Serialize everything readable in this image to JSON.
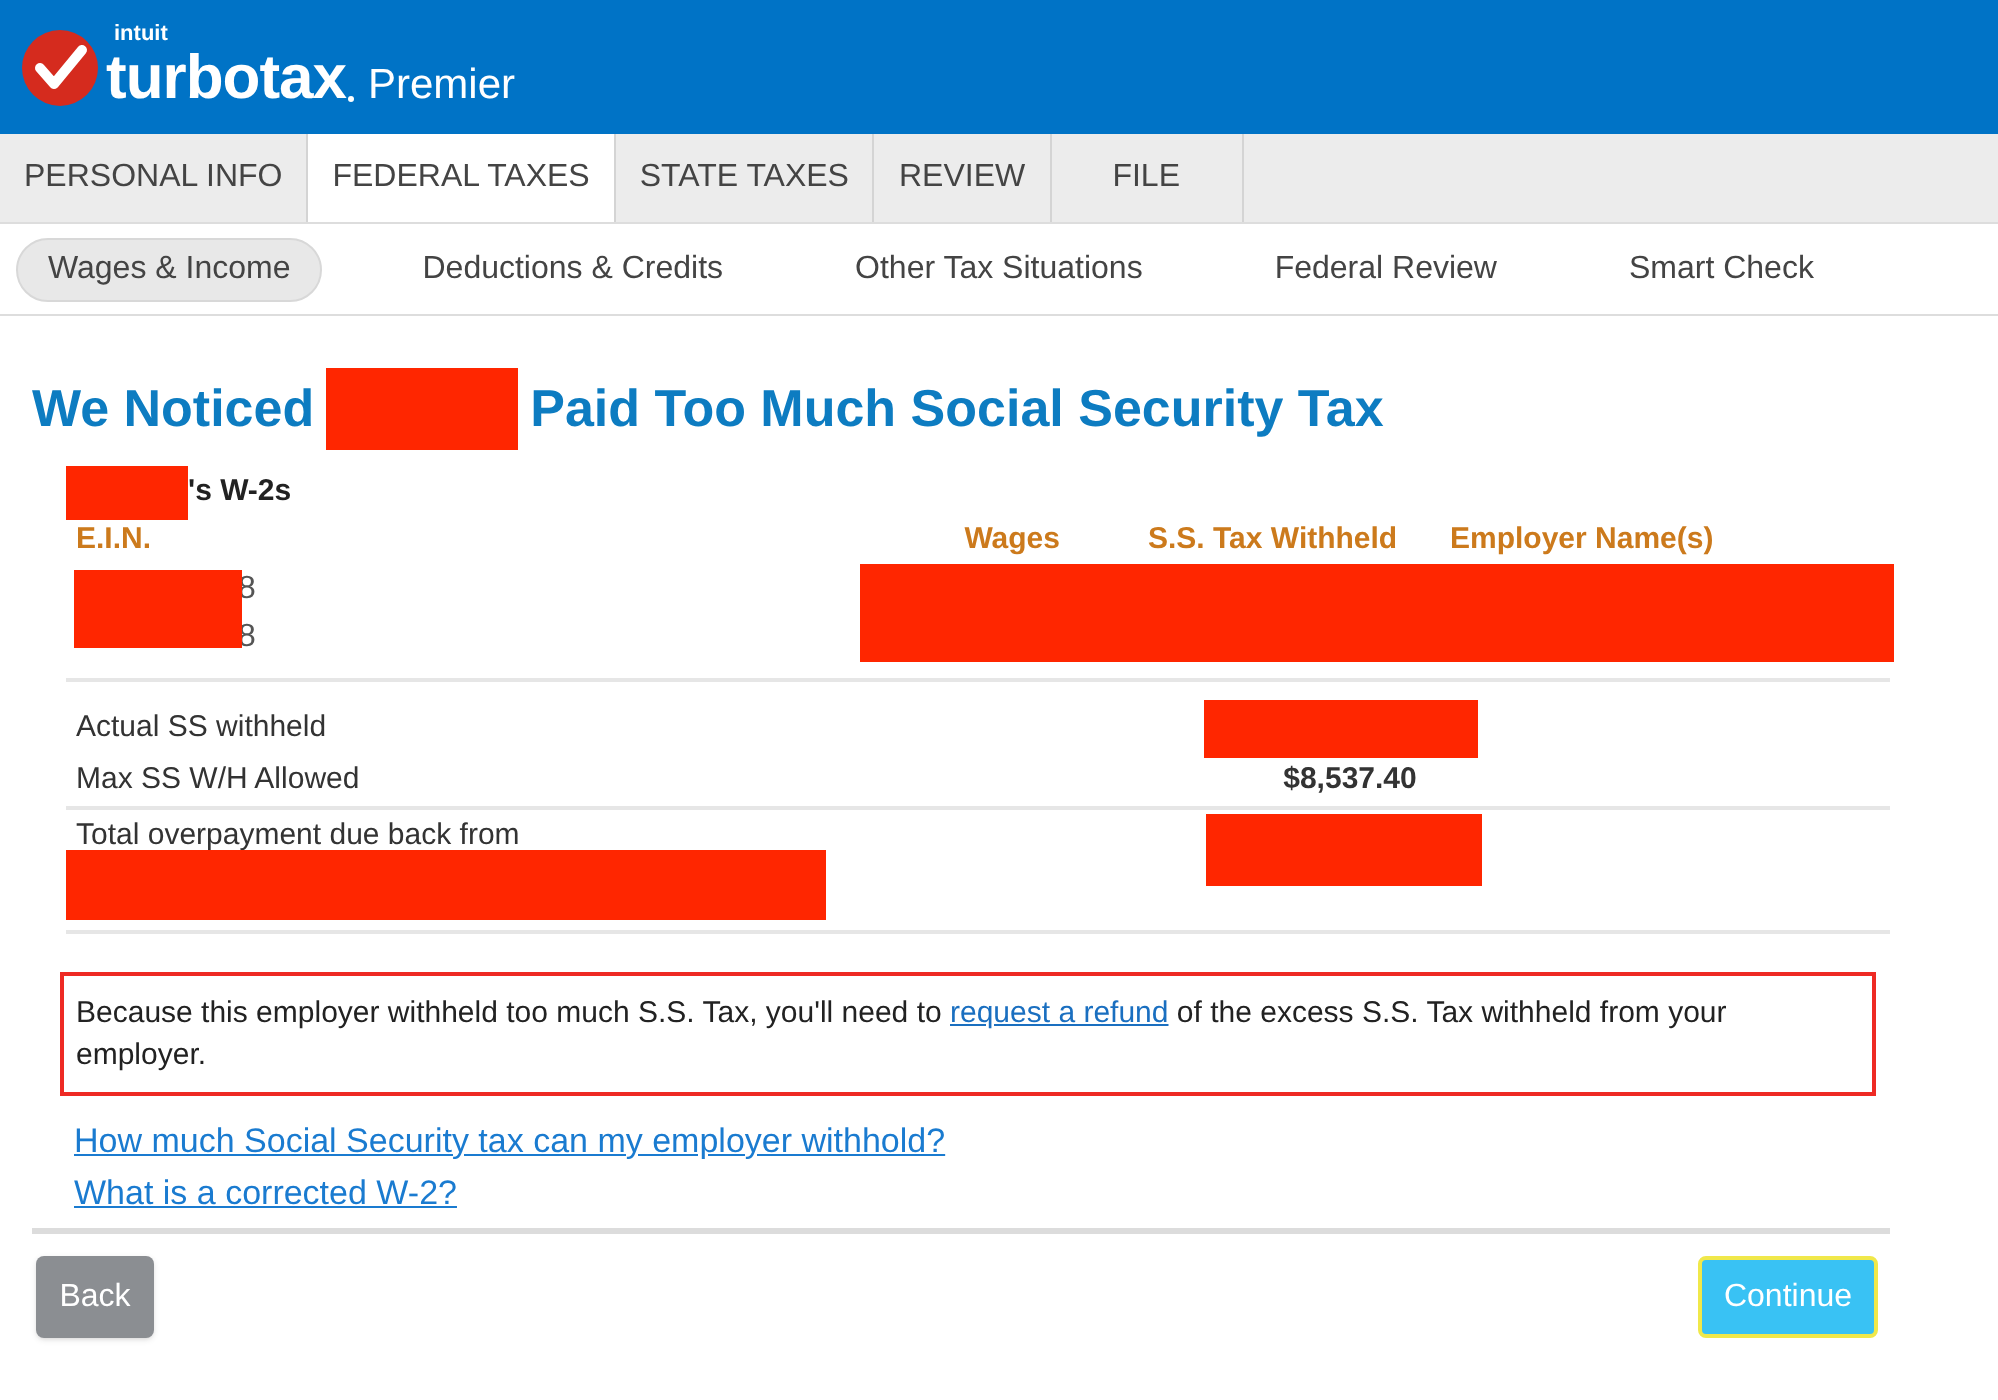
{
  "header": {
    "company": "intuit",
    "brand": "turbotax",
    "edition": "Premier"
  },
  "tabs": [
    {
      "label": "PERSONAL INFO",
      "selected": false
    },
    {
      "label": "FEDERAL TAXES",
      "selected": true
    },
    {
      "label": "STATE TAXES",
      "selected": false
    },
    {
      "label": "REVIEW",
      "selected": false
    },
    {
      "label": "FILE",
      "selected": false
    }
  ],
  "subnav": [
    {
      "label": "Wages & Income",
      "selected": true
    },
    {
      "label": "Deductions & Credits",
      "selected": false
    },
    {
      "label": "Other Tax Situations",
      "selected": false
    },
    {
      "label": "Federal Review",
      "selected": false
    },
    {
      "label": "Smart Check",
      "selected": false
    }
  ],
  "title": {
    "before": "We Noticed",
    "after": "Paid Too Much Social Security Tax"
  },
  "w2": {
    "heading": "'s W-2s",
    "columns": [
      "E.I.N.",
      "Wages",
      "S.S. Tax Withheld",
      "Employer Name(s)"
    ],
    "ein_rows": [
      "8",
      "8"
    ]
  },
  "summary": [
    {
      "label": "Actual SS withheld"
    },
    {
      "label": "Max SS W/H Allowed",
      "value": "$8,537.40"
    },
    {
      "label": "Total overpayment due back from"
    }
  ],
  "notice": {
    "before": "Because this employer withheld too much S.S. Tax, you'll need to",
    "link": "request a refund",
    "after": "of the excess S.S. Tax withheld from your employer."
  },
  "links": [
    "How much Social Security tax can my employer withhold?",
    "What is a corrected W-2?"
  ],
  "buttons": {
    "back": "Back",
    "continue": "Continue"
  }
}
